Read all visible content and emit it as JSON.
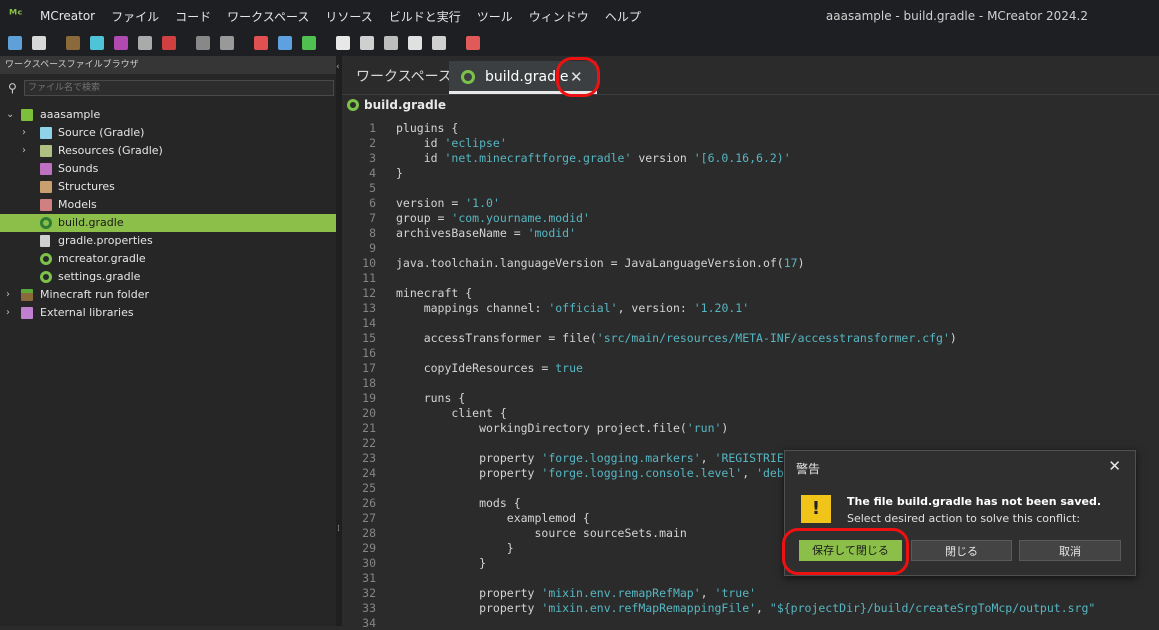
{
  "app": {
    "name": "MCreator",
    "window_title": "aaasample - build.gradle - MCreator 2024.2"
  },
  "menu": [
    "ファイル",
    "コード",
    "ワークスペース",
    "リソース",
    "ビルドと実行",
    "ツール",
    "ウィンドウ",
    "ヘルプ"
  ],
  "sidebar": {
    "header": "ワークスペースファイルブラウザ",
    "search_placeholder": "ファイル名で検索",
    "tree": [
      {
        "label": "aaasample",
        "icon": "workspace-icon"
      },
      {
        "label": "Source (Gradle)",
        "icon": "folder-icon"
      },
      {
        "label": "Resources (Gradle)",
        "icon": "folder-icon"
      },
      {
        "label": "Sounds",
        "icon": "sound-icon"
      },
      {
        "label": "Structures",
        "icon": "structure-icon"
      },
      {
        "label": "Models",
        "icon": "model-icon"
      },
      {
        "label": "build.gradle",
        "icon": "gradle-icon",
        "selected": true
      },
      {
        "label": "gradle.properties",
        "icon": "file-icon"
      },
      {
        "label": "mcreator.gradle",
        "icon": "gradle-icon"
      },
      {
        "label": "settings.gradle",
        "icon": "gradle-icon"
      },
      {
        "label": "Minecraft run folder",
        "icon": "grass-block-icon"
      },
      {
        "label": "External libraries",
        "icon": "library-icon"
      }
    ]
  },
  "tabs": {
    "workspace": "ワークスペース",
    "file": "build.gradle"
  },
  "editor": {
    "filename": "build.gradle",
    "lines": [
      {
        "n": "1",
        "h": "plugins {"
      },
      {
        "n": "2",
        "h": "    id <span class=\"s\">'eclipse'</span>"
      },
      {
        "n": "3",
        "h": "    id <span class=\"s\">'net.minecraftforge.gradle'</span> version <span class=\"s\">'[6.0.16,6.2)'</span>"
      },
      {
        "n": "4",
        "h": "}"
      },
      {
        "n": "5",
        "h": ""
      },
      {
        "n": "6",
        "h": "version = <span class=\"s\">'1.0'</span>"
      },
      {
        "n": "7",
        "h": "group = <span class=\"s\">'com.yourname.modid'</span>"
      },
      {
        "n": "8",
        "h": "archivesBaseName = <span class=\"s\">'modid'</span>"
      },
      {
        "n": "9",
        "h": ""
      },
      {
        "n": "10",
        "h": "java.toolchain.languageVersion = JavaLanguageVersion.of(<span class=\"s\">17</span>)"
      },
      {
        "n": "11",
        "h": ""
      },
      {
        "n": "12",
        "h": "minecraft {"
      },
      {
        "n": "13",
        "h": "    mappings channel: <span class=\"s\">'official'</span>, version: <span class=\"s\">'1.20.1'</span>"
      },
      {
        "n": "14",
        "h": ""
      },
      {
        "n": "15",
        "h": "    accessTransformer = file(<span class=\"s\">'src/main/resources/META-INF/accesstransformer.cfg'</span>)"
      },
      {
        "n": "16",
        "h": ""
      },
      {
        "n": "17",
        "h": "    copyIdeResources = <span class=\"s\">true</span>"
      },
      {
        "n": "18",
        "h": ""
      },
      {
        "n": "19",
        "h": "    runs {"
      },
      {
        "n": "20",
        "h": "        client {"
      },
      {
        "n": "21",
        "h": "            workingDirectory project.file(<span class=\"s\">'run'</span>)"
      },
      {
        "n": "22",
        "h": ""
      },
      {
        "n": "23",
        "h": "            property <span class=\"s\">'forge.logging.markers'</span>, <span class=\"s\">'REGISTRIE</span>"
      },
      {
        "n": "24",
        "h": "            property <span class=\"s\">'forge.logging.console.level'</span>, <span class=\"s\">'deb</span>"
      },
      {
        "n": "25",
        "h": ""
      },
      {
        "n": "26",
        "h": "            mods {"
      },
      {
        "n": "27",
        "h": "                examplemod {"
      },
      {
        "n": "28",
        "h": "                    source sourceSets.main"
      },
      {
        "n": "29",
        "h": "                }"
      },
      {
        "n": "30",
        "h": "            }"
      },
      {
        "n": "31",
        "h": ""
      },
      {
        "n": "32",
        "h": "            property <span class=\"s\">'mixin.env.remapRefMap'</span>, <span class=\"s\">'true'</span>"
      },
      {
        "n": "33",
        "h": "            property <span class=\"s\">'mixin.env.refMapRemappingFile'</span>, <span class=\"s\">\"${projectDir}/build/createSrgToMcp/output.srg\"</span>"
      },
      {
        "n": "34",
        "h": ""
      }
    ]
  },
  "dialog": {
    "title": "警告",
    "message_bold": "The file build.gradle has not been saved.",
    "message": "Select desired action to solve this conflict:",
    "buttons": {
      "save_close": "保存して閉じる",
      "close": "閉じる",
      "cancel": "取消"
    }
  },
  "colors": {
    "accent": "#8cbf4a",
    "highlight": "#e11111",
    "warning": "#f0c419"
  }
}
